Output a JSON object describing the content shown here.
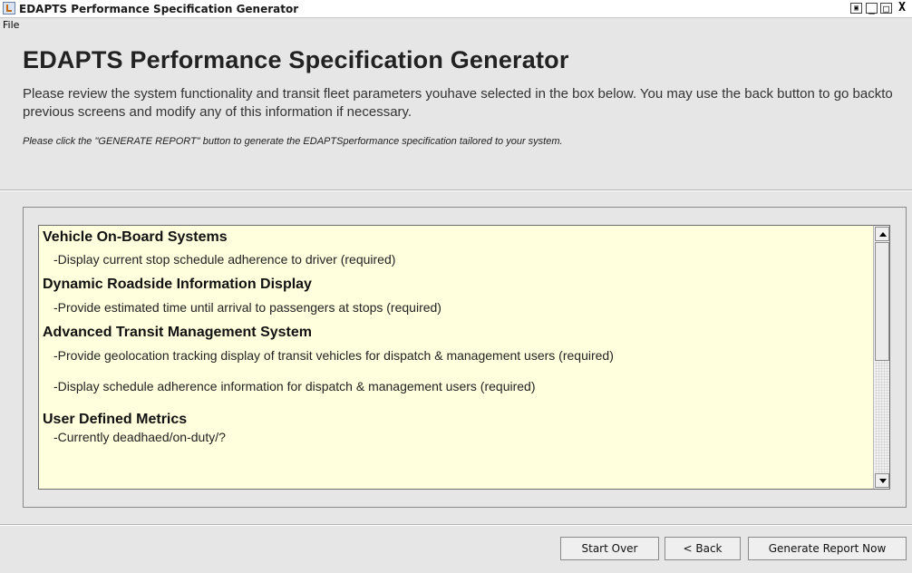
{
  "window": {
    "title": "EDAPTS Performance Specification Generator",
    "controls": {
      "restore": "▣",
      "minimize": "_",
      "maximize": "□",
      "close": "X"
    }
  },
  "menubar": {
    "file": "File"
  },
  "header": {
    "title": "EDAPTS Performance Specification Generator",
    "description": "Please review the system functionality and transit fleet parameters youhave selected in the box below. You may use the back button to go backto previous screens and modify any of this information if necessary.",
    "note": "Please click the \"GENERATE REPORT\" button to generate the EDAPTSperformance specification tailored to your system."
  },
  "summary": {
    "sections": [
      {
        "title": "Vehicle On-Board Systems",
        "items": [
          "-Display current stop schedule adherence to driver  (required)"
        ]
      },
      {
        "title": "Dynamic Roadside Information Display",
        "items": [
          "-Provide estimated time until arrival to passengers at stops (required)"
        ]
      },
      {
        "title": "Advanced Transit Management System",
        "items": [
          "-Provide geolocation tracking display of transit vehicles for dispatch & management users (required)",
          "-Display schedule adherence information for dispatch & management users (required)"
        ]
      },
      {
        "title": "User Defined Metrics",
        "items": [
          "-Currently deadhaed/on-duty/?"
        ]
      }
    ]
  },
  "buttons": {
    "start_over": "Start Over",
    "back": "< Back",
    "generate": "Generate Report Now"
  },
  "colors": {
    "window_bg": "#e6e6e6",
    "list_bg": "#ffffdd"
  },
  "icons": {
    "app": "java-cup-icon",
    "scroll_up": "arrow-up-icon",
    "scroll_down": "arrow-down-icon"
  }
}
